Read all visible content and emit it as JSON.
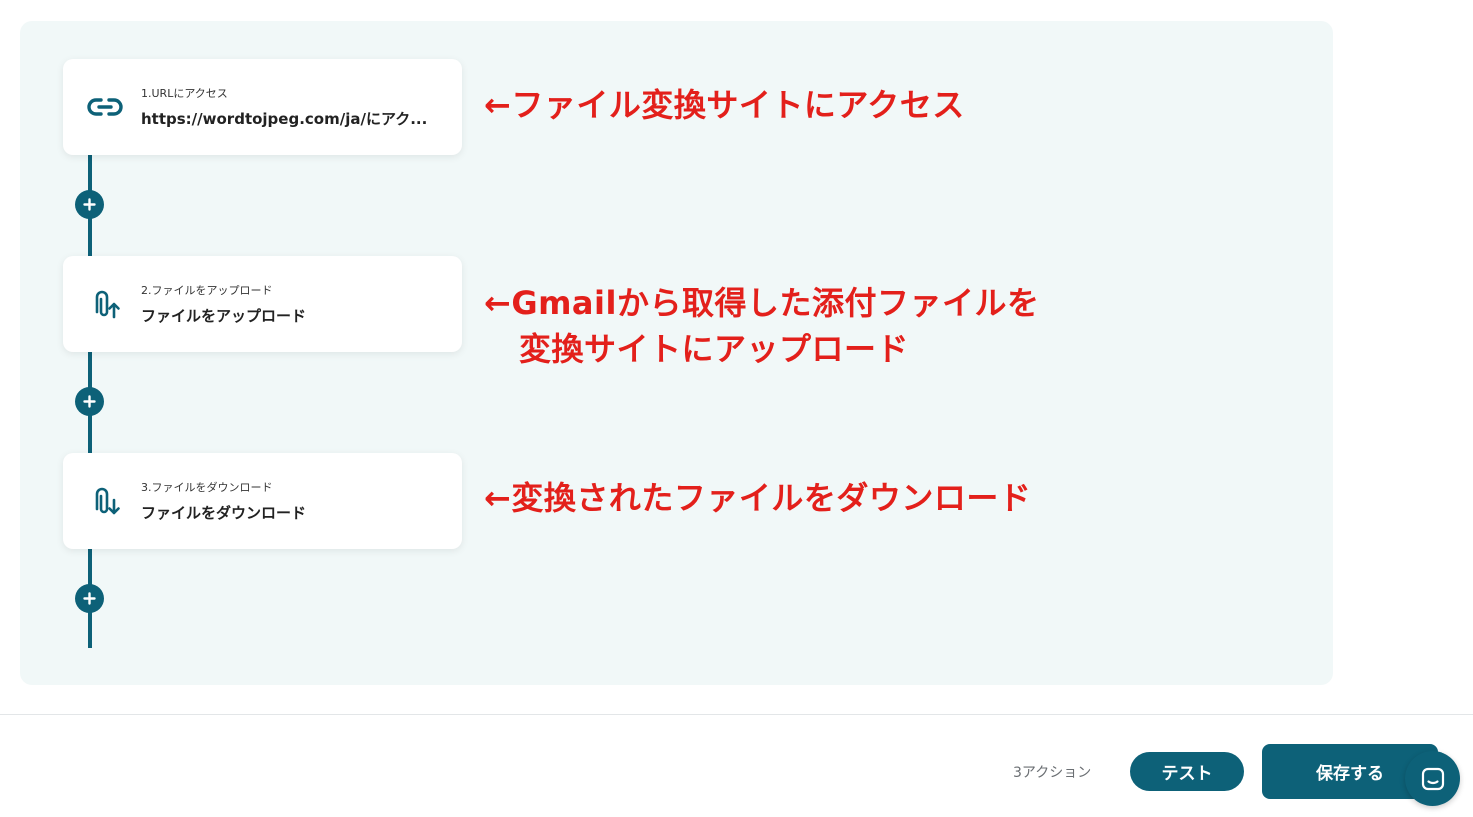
{
  "flow": {
    "steps": [
      {
        "step_label": "1.URLにアクセス",
        "title": "https://wordtojpeg.com/ja/にアク...",
        "icon": "link-icon"
      },
      {
        "step_label": "2.ファイルをアップロード",
        "title": "ファイルをアップロード",
        "icon": "paperclip-upload-icon"
      },
      {
        "step_label": "3.ファイルをダウンロード",
        "title": "ファイルをダウンロード",
        "icon": "paperclip-download-icon"
      }
    ]
  },
  "annotations": {
    "note1": "←ファイル変換サイトにアクセス",
    "note2_line1": "←Gmailから取得した添付ファイルを",
    "note2_line2": "変換サイトにアップロード",
    "note3": "←変換されたファイルをダウンロード"
  },
  "footer": {
    "action_count": "3アクション",
    "test_label": "テスト",
    "save_label": "保存する"
  },
  "colors": {
    "primary": "#0d6178",
    "annotation": "#e3201b",
    "canvas_bg": "#f1f8f8"
  }
}
